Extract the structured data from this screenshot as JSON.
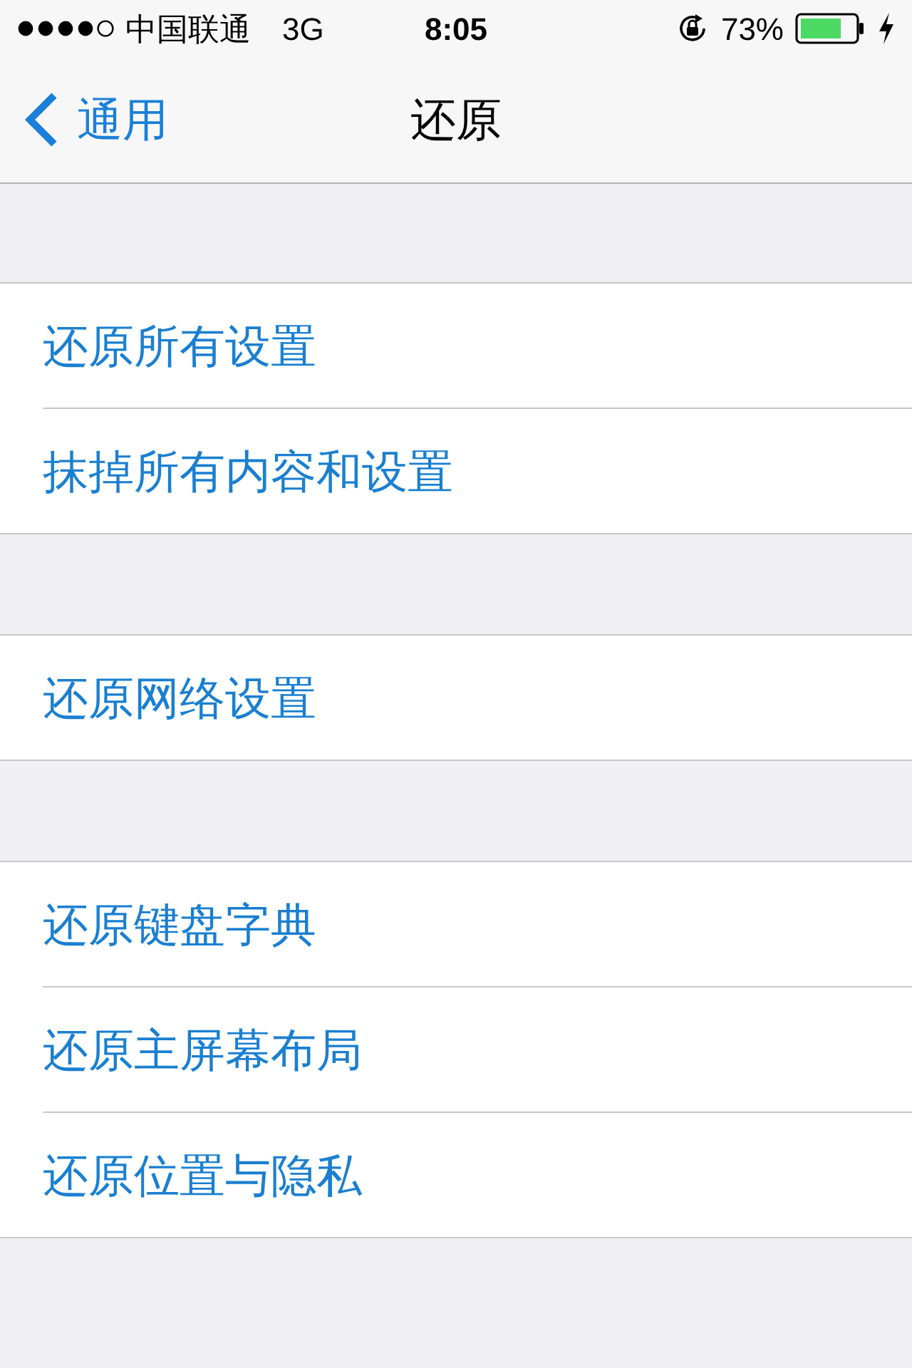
{
  "status_bar": {
    "carrier": "中国联通",
    "network": "3G",
    "time": "8:05",
    "battery_percent": "73%",
    "charging": true
  },
  "nav_bar": {
    "back": "通用",
    "title": "还原"
  },
  "groups": [
    {
      "items": [
        "还原所有设置",
        "抹掉所有内容和设置"
      ]
    },
    {
      "items": [
        "还原网络设置"
      ]
    },
    {
      "items": [
        "还原键盘字典",
        "还原主屏幕布局",
        "还原位置与隐私"
      ]
    }
  ]
}
